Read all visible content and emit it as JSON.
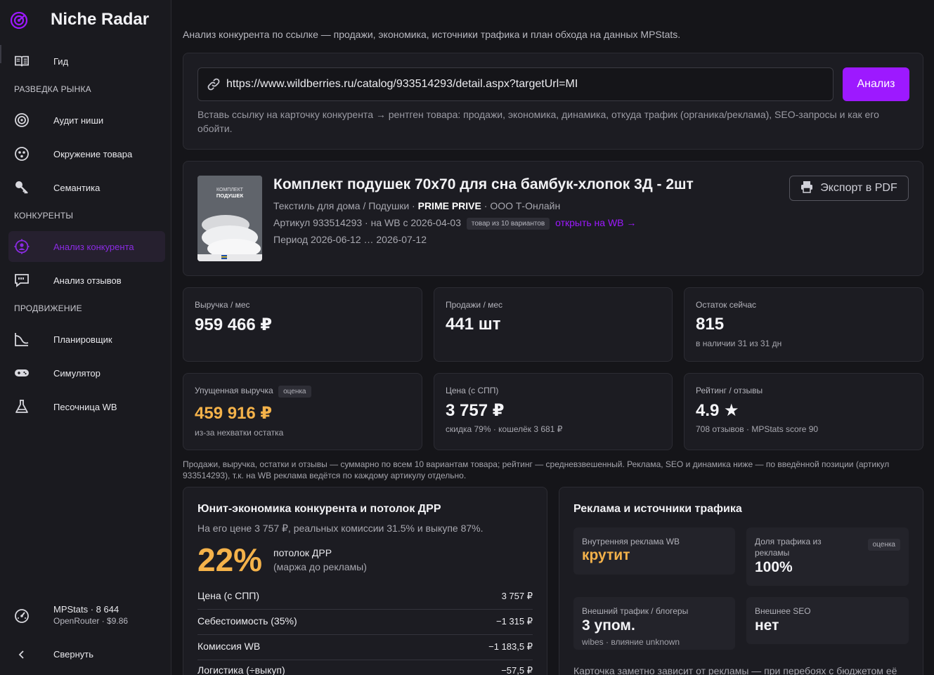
{
  "app": {
    "name": "Niche Radar"
  },
  "sidebar": {
    "guide": "Гид",
    "sections": [
      "РАЗВЕДКА РЫНКА",
      "КОНКУРЕНТЫ",
      "ПРОДВИЖЕНИЕ"
    ],
    "items": [
      {
        "label": "Аудит ниши",
        "icon": "target-icon"
      },
      {
        "label": "Окружение товара",
        "icon": "cluster-icon"
      },
      {
        "label": "Семантика",
        "icon": "key-icon"
      },
      {
        "label": "Анализ конкурента",
        "icon": "crosshair-user-icon",
        "active": true
      },
      {
        "label": "Анализ отзывов",
        "icon": "quote-bubble-icon"
      },
      {
        "label": "Планировщик",
        "icon": "chart-planner-icon"
      },
      {
        "label": "Симулятор",
        "icon": "gamepad-icon"
      },
      {
        "label": "Песочница WB",
        "icon": "flask-icon"
      }
    ],
    "footer": {
      "balance_line1": "MPStats · 8 644",
      "balance_line2": "OpenRouter · $9.86",
      "collapse": "Свернуть"
    }
  },
  "intro": "Анализ конкурента по ссылке — продажи, экономика, источники трафика и план обхода на данных MPStats.",
  "search": {
    "value": "https://www.wildberries.ru/catalog/933514293/detail.aspx?targetUrl=MI",
    "button": "Анализ",
    "hint": "Вставь ссылку на карточку конкурента → рентген товара: продажи, экономика, динамика, откуда трафик (органика/реклама), SEO-запросы и как его обойти."
  },
  "product": {
    "title": "Комплект подушек 70х70 для сна бамбук-хлопок 3Д - 2шт",
    "category": "Текстиль для дома / Подушки",
    "brand": "PRIME PRIVE",
    "seller": "ООО Т-Онлайн",
    "article": "Артикул 933514293",
    "since": "на WB с 2026-04-03",
    "variants_badge": "товар из 10 вариантов",
    "wb_link": "открыть на WB →",
    "period": "Период 2026-06-12 … 2026-07-12",
    "export_button": "Экспорт в PDF",
    "thumb_text1": "КОМПЛЕКТ",
    "thumb_text2": "ПОДУШЕК"
  },
  "stats": [
    {
      "title": "Выручка / мес",
      "value": "959 466 ₽",
      "sub": ""
    },
    {
      "title": "Продажи / мес",
      "value": "441 шт",
      "sub": ""
    },
    {
      "title": "Остаток сейчас",
      "value": "815",
      "sub": "в наличии 31 из 31 дн"
    },
    {
      "title": "Упущенная выручка",
      "badge": "оценка",
      "value": "459 916 ₽",
      "sub": "из-за нехватки остатка"
    },
    {
      "title": "Цена (с СПП)",
      "value": "3 757 ₽",
      "sub": "скидка 79% · кошелёк 3 681 ₽"
    },
    {
      "title": "Рейтинг / отзывы",
      "value": "4.9 ★",
      "sub": "708 отзывов · MPStats score 90"
    }
  ],
  "note": "Продажи, выручка, остатки и отзывы — суммарно по всем 10 вариантам товара; рейтинг — средневзвешенный. Реклама, SEO и динамика ниже — по введённой позиции (артикул 933514293), т.к. на WB реклама ведётся по каждому артикулу отдельно.",
  "unit_econ": {
    "title": "Юнит-экономика конкурента и потолок ДРР",
    "subtitle": "На его цене 3 757 ₽, реальных комиссии 31.5% и выкупе 87%.",
    "pct": "22%",
    "pct_label1": "потолок ДРР",
    "pct_label2": "(маржа до рекламы)",
    "rows": [
      {
        "k": "Цена (с СПП)",
        "v": "3 757 ₽"
      },
      {
        "k": "Себестоимость (35%)",
        "v": "−1 315 ₽"
      },
      {
        "k": "Комиссия WB",
        "v": "−1 183,5 ₽"
      },
      {
        "k": "Логистика (÷выкуп)",
        "v": "−57,5 ₽"
      }
    ]
  },
  "traffic": {
    "title": "Реклама и источники трафика",
    "tiles": [
      {
        "title": "Внутренняя реклама WB",
        "value": "крутит",
        "orange": true
      },
      {
        "title": "Доля трафика из рекламы",
        "badge": "оценка",
        "value": "100%"
      },
      {
        "title": "Внешний трафик / блогеры",
        "value": "3 упом.",
        "sub": "wibes · влияние unknown"
      },
      {
        "title": "Внешнее SEO",
        "value": "нет"
      }
    ],
    "note": "Карточка заметно зависит от рекламы — при перебоях с бюджетом её"
  },
  "colors": {
    "accent": "#9d19ff",
    "orange": "#f4b24a",
    "bg": "#151519",
    "card": "#1c1c22"
  }
}
